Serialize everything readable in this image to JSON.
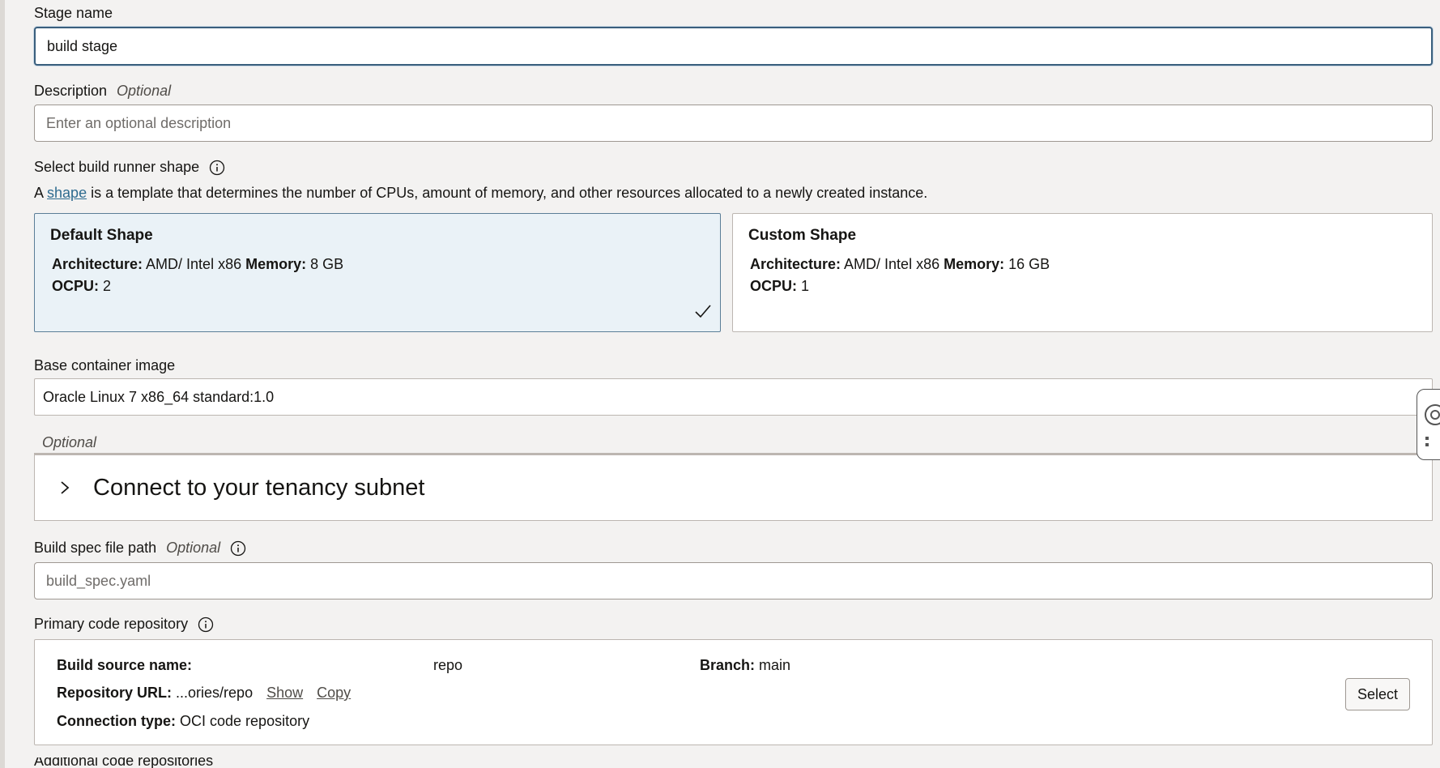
{
  "stage_name": {
    "label": "Stage name",
    "value": "build stage"
  },
  "description": {
    "label": "Description",
    "optional": "Optional",
    "placeholder": "Enter an optional description"
  },
  "runner_shape": {
    "label": "Select build runner shape",
    "desc_prefix": "A",
    "desc_link": "shape",
    "desc_suffix": "is a template that determines the number of CPUs, amount of memory, and other resources allocated to a newly created instance.",
    "cards": [
      {
        "title": "Default Shape",
        "arch_label": "Architecture:",
        "arch_value": "AMD/ Intel x86",
        "mem_label": "Memory:",
        "mem_value": "8 GB",
        "ocpu_label": "OCPU:",
        "ocpu_value": "2",
        "selected": true
      },
      {
        "title": "Custom Shape",
        "arch_label": "Architecture:",
        "arch_value": "AMD/ Intel x86",
        "mem_label": "Memory:",
        "mem_value": "16 GB",
        "ocpu_label": "OCPU:",
        "ocpu_value": "1",
        "selected": false
      }
    ]
  },
  "base_image": {
    "label": "Base container image",
    "value": "Oracle Linux 7 x86_64 standard:1.0"
  },
  "subnet": {
    "optional": "Optional",
    "title": "Connect to your tenancy subnet"
  },
  "build_spec": {
    "label": "Build spec file path",
    "optional": "Optional",
    "placeholder": "build_spec.yaml"
  },
  "primary_repo": {
    "label": "Primary code repository",
    "source_name_label": "Build source name:",
    "source_name_value": "repo",
    "branch_label": "Branch:",
    "branch_value": "main",
    "url_label": "Repository URL:",
    "url_value": "...ories/repo",
    "show_link": "Show",
    "copy_link": "Copy",
    "conn_label": "Connection type:",
    "conn_value": "OCI code repository",
    "select_button": "Select"
  },
  "next_section_label": "Additional code repositories",
  "colors": {
    "background": "#f3f2f1",
    "selected_card": "#eaf2f7",
    "link": "#2e6b8f",
    "focus_border": "#3a5f7d"
  }
}
